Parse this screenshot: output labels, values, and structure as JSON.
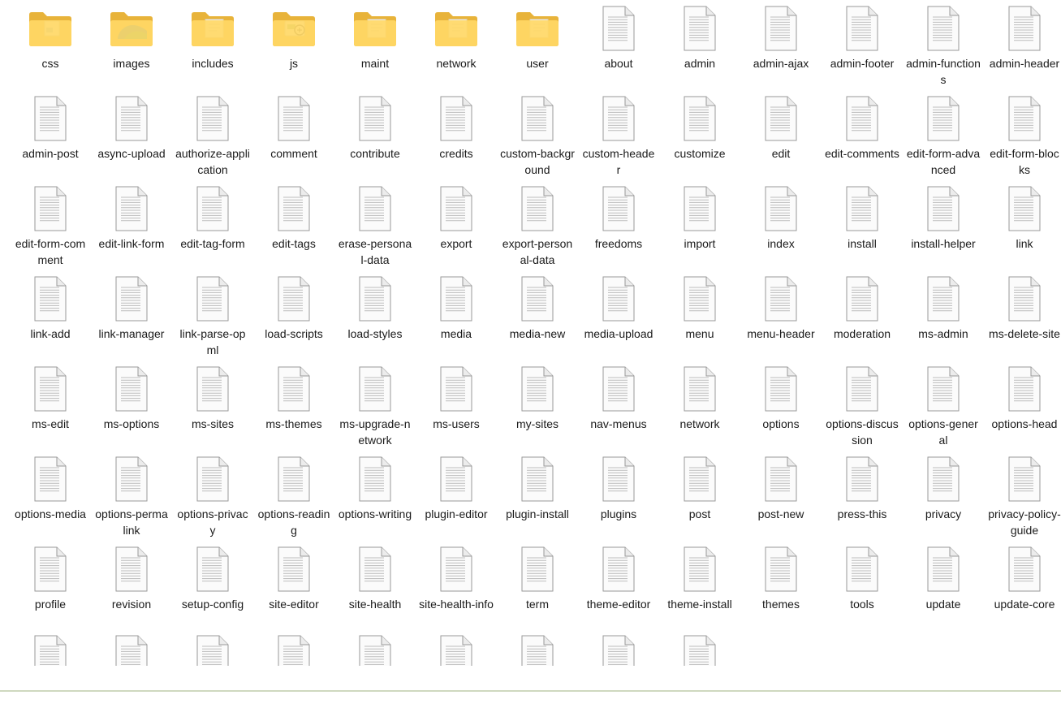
{
  "folders": [
    {
      "label": "css",
      "overlay": "css"
    },
    {
      "label": "images",
      "overlay": "images"
    },
    {
      "label": "includes",
      "overlay": "doc"
    },
    {
      "label": "js",
      "overlay": "js"
    },
    {
      "label": "maint",
      "overlay": "doc"
    },
    {
      "label": "network",
      "overlay": "doc"
    },
    {
      "label": "user",
      "overlay": "doc"
    }
  ],
  "files": [
    "about",
    "admin",
    "admin-ajax",
    "admin-footer",
    "admin-functions",
    "admin-header",
    "admin-post",
    "async-upload",
    "authorize-application",
    "comment",
    "contribute",
    "credits",
    "custom-background",
    "custom-header",
    "customize",
    "edit",
    "edit-comments",
    "edit-form-advanced",
    "edit-form-blocks",
    "edit-form-comment",
    "edit-link-form",
    "edit-tag-form",
    "edit-tags",
    "erase-personal-data",
    "export",
    "export-personal-data",
    "freedoms",
    "import",
    "index",
    "install",
    "install-helper",
    "link",
    "link-add",
    "link-manager",
    "link-parse-opml",
    "load-scripts",
    "load-styles",
    "media",
    "media-new",
    "media-upload",
    "menu",
    "menu-header",
    "moderation",
    "ms-admin",
    "ms-delete-site",
    "ms-edit",
    "ms-options",
    "ms-sites",
    "ms-themes",
    "ms-upgrade-network",
    "ms-users",
    "my-sites",
    "nav-menus",
    "network",
    "options",
    "options-discussion",
    "options-general",
    "options-head",
    "options-media",
    "options-permalink",
    "options-privacy",
    "options-reading",
    "options-writing",
    "plugin-editor",
    "plugin-install",
    "plugins",
    "post",
    "post-new",
    "press-this",
    "privacy",
    "privacy-policy-guide",
    "profile",
    "revision",
    "setup-config",
    "site-editor",
    "site-health",
    "site-health-info",
    "term",
    "theme-editor",
    "theme-install",
    "themes",
    "tools",
    "update",
    "update-core"
  ],
  "partial_row_count": 9,
  "icons": {
    "folder": "folder-icon",
    "file": "document-file-icon"
  },
  "colors": {
    "folder_back": "#e8b33a",
    "folder_front": "#ffd866",
    "accent": "#0f7aa8"
  }
}
